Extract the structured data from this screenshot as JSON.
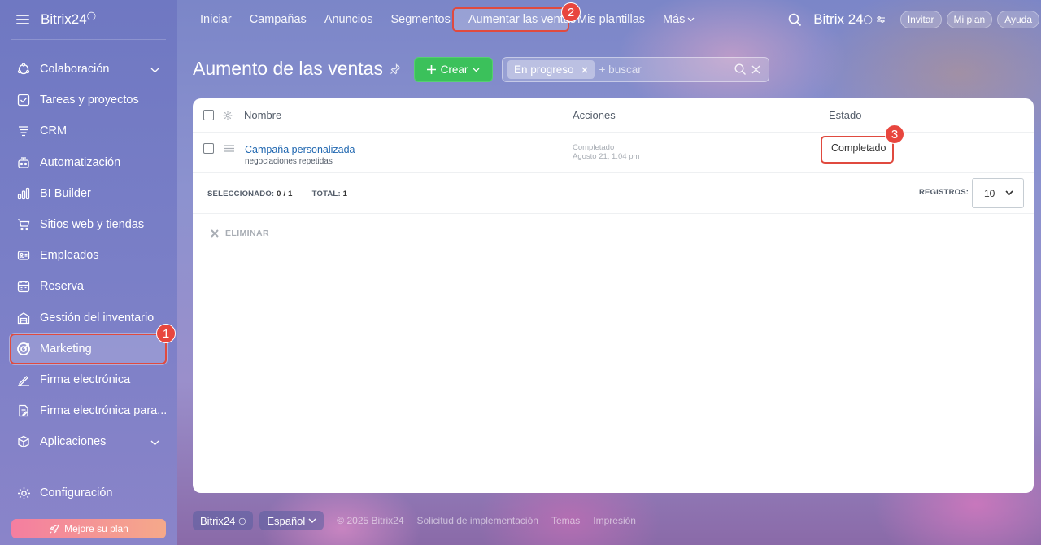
{
  "sidebar": {
    "logo": "Bitrix24",
    "items": [
      {
        "label": "Colaboración",
        "icon": "collaboration-icon",
        "has_chevron": true
      },
      {
        "label": "Tareas y proyectos",
        "icon": "tasks-icon"
      },
      {
        "label": "CRM",
        "icon": "crm-icon"
      },
      {
        "label": "Automatización",
        "icon": "automation-icon"
      },
      {
        "label": "BI Builder",
        "icon": "bi-builder-icon"
      },
      {
        "label": "Sitios web y tiendas",
        "icon": "cart-icon"
      },
      {
        "label": "Empleados",
        "icon": "employees-icon"
      },
      {
        "label": "Reserva",
        "icon": "booking-icon"
      },
      {
        "label": "Gestión del inventario",
        "icon": "inventory-icon"
      },
      {
        "label": "Marketing",
        "icon": "marketing-icon",
        "active": true
      },
      {
        "label": "Firma electrónica",
        "icon": "signature-icon"
      },
      {
        "label": "Firma electrónica para...",
        "icon": "signature-doc-icon"
      },
      {
        "label": "Aplicaciones",
        "icon": "apps-icon",
        "has_chevron": true
      }
    ],
    "config_label": "Configuración",
    "upgrade_label": "Mejore su plan"
  },
  "topnav": {
    "tabs": [
      "Iniciar",
      "Campañas",
      "Anuncios",
      "Segmentos",
      "Aumentar las ventas",
      "Mis plantillas",
      "Más"
    ],
    "active_tab": "Aumentar las ventas",
    "logo": "Bitrix 24",
    "invite": "Invitar",
    "my_plan": "Mi plan",
    "help": "Ayuda"
  },
  "header": {
    "title": "Aumento de las ventas",
    "create_label": "Crear",
    "filter_chip": "En progreso",
    "search_placeholder": "+ buscar"
  },
  "table": {
    "columns": [
      "Nombre",
      "Acciones",
      "Estado"
    ],
    "rows": [
      {
        "name": "Campaña personalizada",
        "subtitle": "negociaciones repetidas",
        "action_status": "Completado",
        "action_date": "Agosto 21, 1:04 pm",
        "state": "Completado"
      }
    ],
    "selected_label": "SELECCIONADO:",
    "selected_value": "0 / 1",
    "total_label": "TOTAL:",
    "total_value": "1",
    "records_label": "REGISTROS:",
    "records_value": "10",
    "delete_label": "ELIMINAR"
  },
  "footer": {
    "logo": "Bitrix24",
    "language": "Español",
    "copyright": "© 2025 Bitrix24",
    "links": [
      "Solicitud de implementación",
      "Temas",
      "Impresión"
    ]
  },
  "annotations": [
    "1",
    "2",
    "3"
  ],
  "colors": {
    "accent_green": "#3bc15b",
    "highlight_red": "#e04a3f",
    "link_blue": "#2067b0"
  }
}
